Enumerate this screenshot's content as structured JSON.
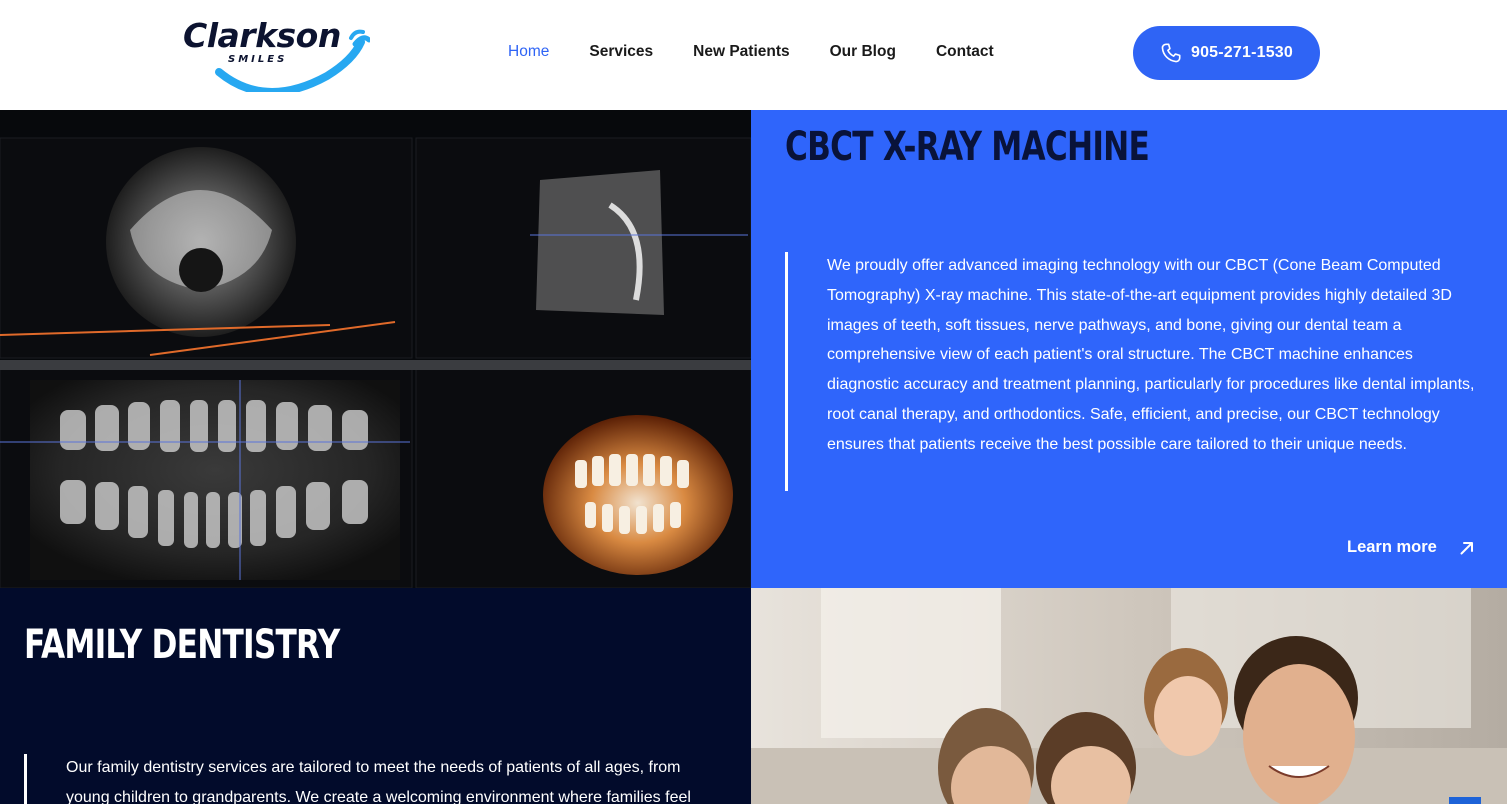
{
  "header": {
    "logo": {
      "name": "Clarkson",
      "tagline": "SMILES"
    },
    "nav": [
      {
        "label": "Home",
        "active": true
      },
      {
        "label": "Services",
        "active": false
      },
      {
        "label": "New Patients",
        "active": false
      },
      {
        "label": "Our Blog",
        "active": false
      },
      {
        "label": "Contact",
        "active": false
      }
    ],
    "phone": {
      "label": "905-271-1530",
      "icon": "phone-icon"
    }
  },
  "sections": {
    "cbct": {
      "title": "CBCT X-RAY MACHINE",
      "body": "We proudly offer advanced imaging technology with our CBCT (Cone Beam Computed Tomography) X-ray machine. This state-of-the-art equipment provides highly detailed 3D images of teeth, soft tissues, nerve pathways, and bone, giving our dental team a comprehensive view of each patient's oral structure. The CBCT machine enhances diagnostic accuracy and treatment planning, particularly for procedures like dental implants, root canal therapy, and orthodontics. Safe, efficient, and precise, our CBCT technology ensures that patients receive the best possible care tailored to their unique needs.",
      "link_label": "Learn more",
      "link_icon": "arrow-up-right-icon"
    },
    "family": {
      "title": "FAMILY DENTISTRY",
      "body": "Our family dentistry services are tailored to meet the needs of patients of all ages, from young children to grandparents. We create a welcoming environment where families feel"
    }
  },
  "colors": {
    "accent": "#2f64f5",
    "cbct_panel": "#2f65fb",
    "family_panel": "#020b2b",
    "title_dark": "#09133a"
  }
}
